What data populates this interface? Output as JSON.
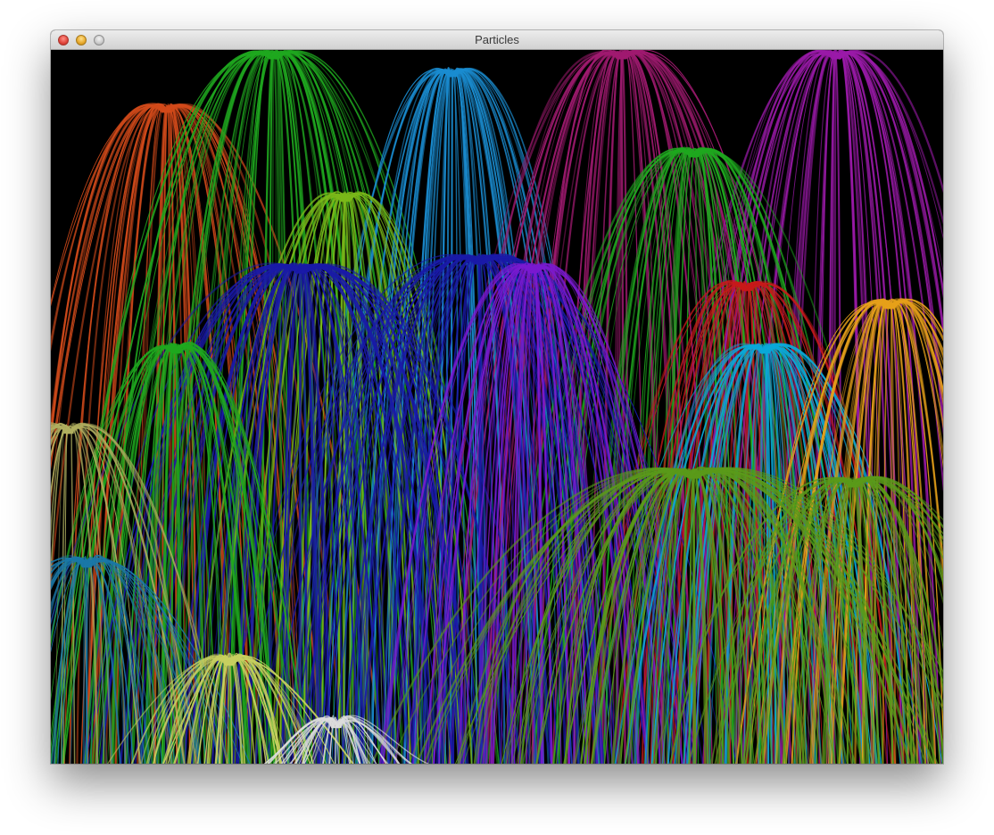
{
  "window": {
    "title": "Particles"
  },
  "titlebar_buttons": {
    "close_icon": "close-icon",
    "minimize_icon": "minimize-icon",
    "zoom_icon": "zoom-icon"
  },
  "canvas": {
    "background": "#000000",
    "fountain_colors": [
      "#d24a1a",
      "#1fa81f",
      "#1a8cd0",
      "#a01a70",
      "#9a1aa8",
      "#7ab81a",
      "#1a1aa8",
      "#7a1ad0",
      "#0aa8d8",
      "#e6a01a",
      "#b0b060",
      "#1a78a8",
      "#c8d060",
      "#dcdcdc",
      "#5a9a1a",
      "#c81a1a"
    ]
  }
}
